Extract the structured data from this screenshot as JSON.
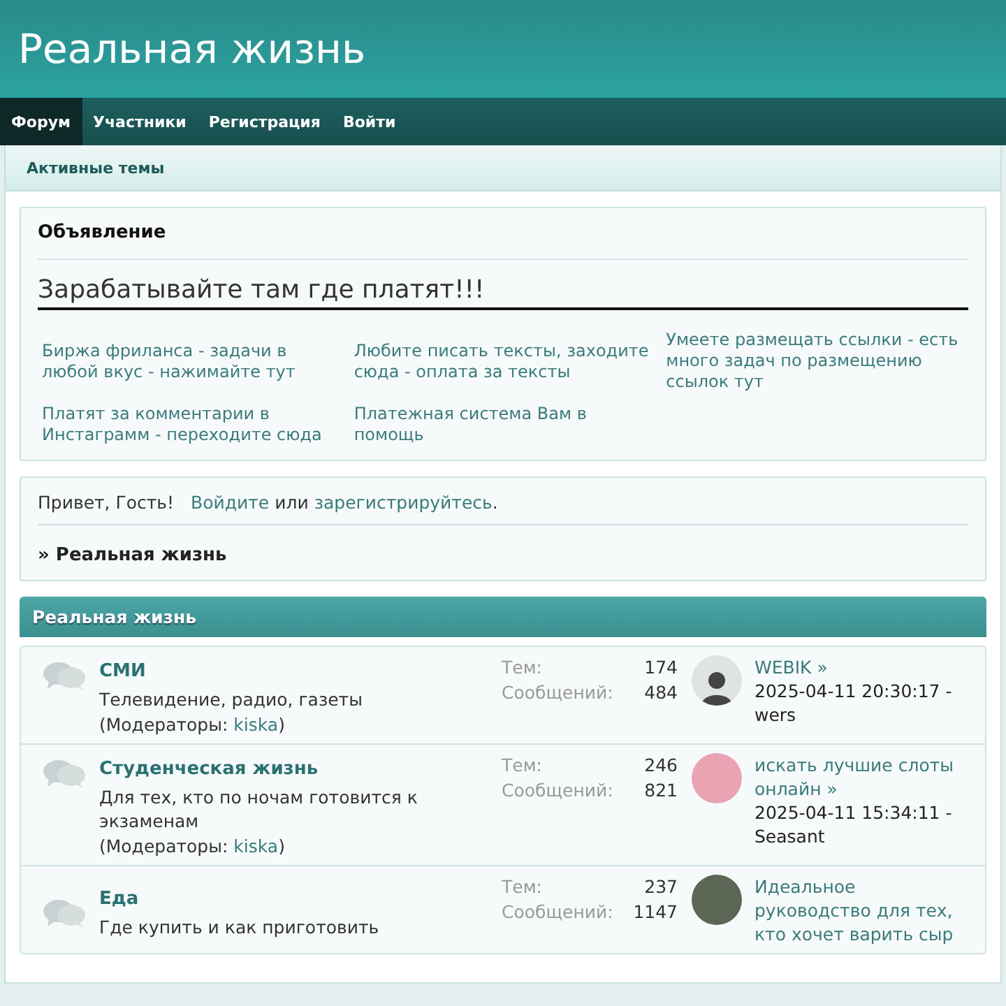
{
  "site_title": "Реальная жизнь",
  "nav": [
    {
      "label": "Форум",
      "selected": true
    },
    {
      "label": "Участники",
      "selected": false
    },
    {
      "label": "Регистрация",
      "selected": false
    },
    {
      "label": "Войти",
      "selected": false
    }
  ],
  "subnav": {
    "label": "Активные темы"
  },
  "announcement": {
    "title": "Объявление",
    "headline": "Зарабатывайте там где платят!!!",
    "links": [
      "Биржа фриланса - задачи в любой вкус - нажимайте тут",
      "Любите писать тексты, заходите сюда - оплата за тексты",
      "Умеете размещать ссылки - есть много задач по размещению ссылок тут",
      "Платят за комментарии в Инстаграмм - переходите сюда",
      "Платежная система Вам в помощь"
    ]
  },
  "welcome": {
    "greeting": "Привет, Гость!",
    "login_link": "Войдите",
    "or": "или",
    "register_link": "зарегистрируйтесь",
    "period": ".",
    "breadcrumb": "» Реальная жизнь"
  },
  "category": {
    "title": "Реальная жизнь",
    "boards": [
      {
        "name": "СМИ",
        "description": "Телевидение, радио, газеты",
        "moderators_label": "(Модераторы:",
        "moderator": "kiska",
        "moderators_close": ")",
        "topics_label": "Тем:",
        "topics": "174",
        "posts_label": "Сообщений:",
        "posts": "484",
        "kind": "silhouette",
        "last_topic": "WEBIK »",
        "last_date": "2025-04-11 20:30:17 -",
        "last_user": "wers"
      },
      {
        "name": "Студенческая жизнь",
        "description": "Для тех, кто по ночам готовится к экзаменам",
        "moderators_label": "(Модераторы:",
        "moderator": "kiska",
        "moderators_close": ")",
        "topics_label": "Тем:",
        "topics": "246",
        "posts_label": "Сообщений:",
        "posts": "821",
        "kind": "photo",
        "last_topic": "искать лучшие слоты онлайн »",
        "last_date": "2025-04-11 15:34:11 -",
        "last_user": "Seasant"
      },
      {
        "name": "Еда",
        "description": "Где купить и как приготовить",
        "topics_label": "Тем:",
        "topics": "237",
        "posts_label": "Сообщений:",
        "posts": "1147",
        "kind": "photo",
        "last_topic": "Идеальное руководство для тех, кто хочет варить сыр"
      }
    ]
  }
}
